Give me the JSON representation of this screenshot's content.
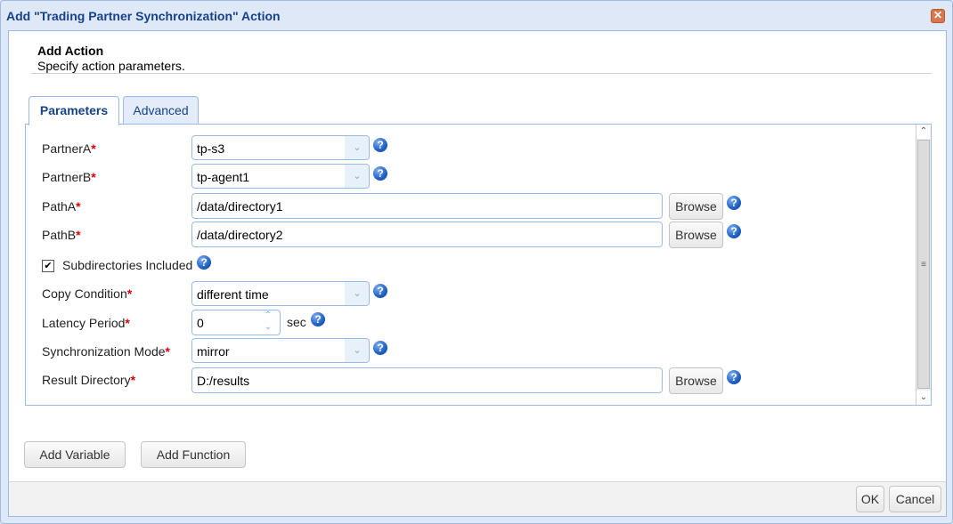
{
  "window": {
    "title": "Add \"Trading Partner Synchronization\" Action",
    "close_label": "✕"
  },
  "header": {
    "title": "Add Action",
    "subtitle": "Specify action parameters."
  },
  "tabs": [
    {
      "label": "Parameters",
      "active": true
    },
    {
      "label": "Advanced",
      "active": false
    }
  ],
  "form": {
    "partnerA": {
      "label": "PartnerA",
      "value": "tp-s3"
    },
    "partnerB": {
      "label": "PartnerB",
      "value": "tp-agent1"
    },
    "pathA": {
      "label": "PathA",
      "value": "/data/directory1"
    },
    "pathB": {
      "label": "PathB",
      "value": "/data/directory2"
    },
    "subdirs": {
      "label": "Subdirectories Included",
      "checked": true,
      "mark": "✔"
    },
    "copyCondition": {
      "label": "Copy Condition",
      "value": "different time"
    },
    "latency": {
      "label": "Latency Period",
      "value": "0",
      "unit": "sec"
    },
    "syncMode": {
      "label": "Synchronization Mode",
      "value": "mirror"
    },
    "resultDir": {
      "label": "Result Directory",
      "value": "D:/results"
    },
    "required_mark": "*",
    "browse_label": "Browse",
    "help_glyph": "?",
    "dropdown_glyph": "⌄",
    "spin_up_glyph": "⌃",
    "spin_down_glyph": "⌄"
  },
  "scrollbar": {
    "up": "⌃",
    "down": "⌄",
    "grip": "≡"
  },
  "actions": {
    "add_variable": "Add Variable",
    "add_function": "Add Function"
  },
  "footer": {
    "ok": "OK",
    "cancel": "Cancel"
  }
}
